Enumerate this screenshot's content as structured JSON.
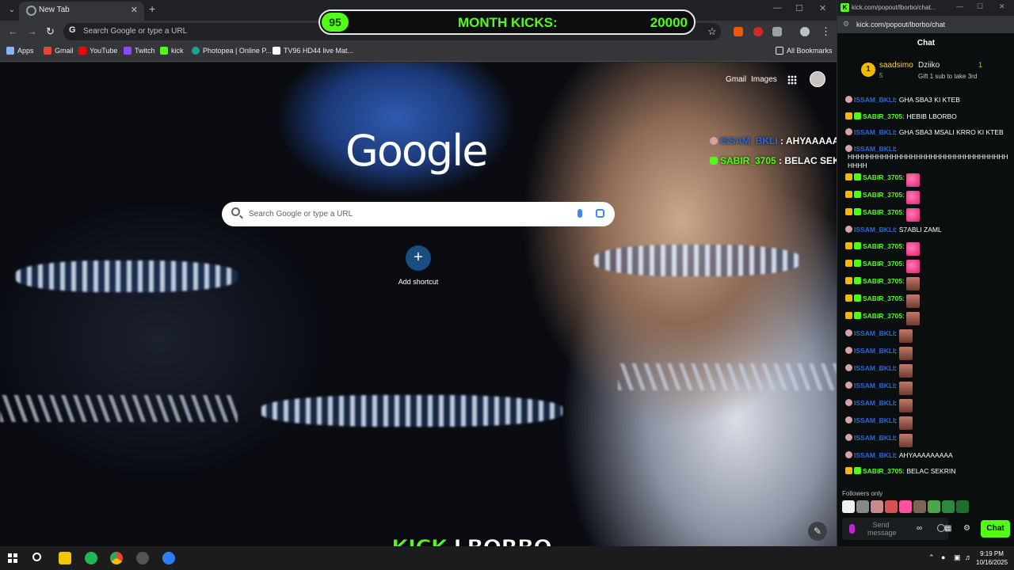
{
  "browser": {
    "tab_title": "New Tab",
    "new_tab": "+",
    "omnibox_placeholder": "Search Google or type a URL",
    "bookmarks": [
      {
        "label": "Apps",
        "color": "#8ab4f8"
      },
      {
        "label": "Gmail",
        "color": "#ea4335"
      },
      {
        "label": "YouTube",
        "color": "#ff0000"
      },
      {
        "label": "Twitch",
        "color": "#9146ff"
      },
      {
        "label": "kick",
        "color": "#53fc18"
      },
      {
        "label": "Photopea | Online P...",
        "color": "#18a497"
      },
      {
        "label": "TV96 HD44 live Mat...",
        "color": "#ffffff"
      }
    ],
    "all_bookmarks": "All Bookmarks"
  },
  "ntp": {
    "gmail": "Gmail",
    "images": "Images",
    "logo": "Google",
    "search_placeholder": "Search Google or type a URL",
    "add_shortcut_icon": "+",
    "add_shortcut": "Add shortcut",
    "customize_icon": "pencil-icon"
  },
  "overlay": {
    "kicks_current": "95",
    "kicks_label": "MONTH KICKS:",
    "kicks_goal": "20000",
    "chat": [
      {
        "user": "ISSAM_BKLI",
        "text": "AHYAAAAAAAAA"
      },
      {
        "user": "SABIR_3705",
        "text": "BELAC SEKRIN"
      }
    ],
    "banner_kick": "KICK",
    "banner_name": "LBORBO"
  },
  "kick": {
    "window_title": "kick.com/popout/lborbo/chat...",
    "url": "kick.com/popout/lborbo/chat",
    "header": "Chat",
    "leaderboard": {
      "rank": "1",
      "first_name": "saadsimo",
      "first_count": "5",
      "second_name": "Dziiko",
      "second_count": "1",
      "gift_text": "Gift 1 sub to take 3rd"
    },
    "colors": {
      "issam": "#2f67d8",
      "sabir": "#53fc18",
      "issam_badge": "#d7a3a3",
      "sabir_badge": "#f5b800"
    },
    "messages": [
      {
        "user": "ISSAM_BKLI",
        "text": "GHA SBA3 KI KTEB",
        "emote": false
      },
      {
        "user": "SABIR_3705",
        "text": "HEBIB LBORBO",
        "emote": false
      },
      {
        "user": "ISSAM_BKLI",
        "text": "GHA SBA3 MSALI KRRO KI KTEB",
        "emote": false
      },
      {
        "user": "ISSAM_BKLI",
        "text": "HHHHHHHHHHHHHHHHHHHHHHHHHHHHHHHHHHHHH",
        "emote": false
      },
      {
        "user": "SABIR_3705",
        "text": "",
        "emote": "pink"
      },
      {
        "user": "SABIR_3705",
        "text": "",
        "emote": "pink"
      },
      {
        "user": "SABIR_3705",
        "text": "",
        "emote": "pink"
      },
      {
        "user": "ISSAM_BKLI",
        "text": "S7ABLI ZAML",
        "emote": false
      },
      {
        "user": "SABIR_3705",
        "text": "",
        "emote": "pink"
      },
      {
        "user": "SABIR_3705",
        "text": "",
        "emote": "pink"
      },
      {
        "user": "SABIR_3705",
        "text": "",
        "emote": "face"
      },
      {
        "user": "SABIR_3705",
        "text": "",
        "emote": "face"
      },
      {
        "user": "SABIR_3705",
        "text": "",
        "emote": "face"
      },
      {
        "user": "ISSAM_BKLI",
        "text": "",
        "emote": "face"
      },
      {
        "user": "ISSAM_BKLI",
        "text": "",
        "emote": "face"
      },
      {
        "user": "ISSAM_BKLI",
        "text": "",
        "emote": "face"
      },
      {
        "user": "ISSAM_BKLI",
        "text": "",
        "emote": "face"
      },
      {
        "user": "ISSAM_BKLI",
        "text": "",
        "emote": "face"
      },
      {
        "user": "ISSAM_BKLI",
        "text": "",
        "emote": "face"
      },
      {
        "user": "ISSAM_BKLI",
        "text": "",
        "emote": "face"
      },
      {
        "user": "ISSAM_BKLI",
        "text": "AHYAAAAAAAAA",
        "emote": false
      },
      {
        "user": "SABIR_3705",
        "text": "BELAC SEKRIN",
        "emote": false
      }
    ],
    "followers_only": "Followers only",
    "input_placeholder": "Send message",
    "chat_button": "Chat"
  },
  "taskbar": {
    "time": "9:19 PM",
    "date": "10/16/2025"
  }
}
